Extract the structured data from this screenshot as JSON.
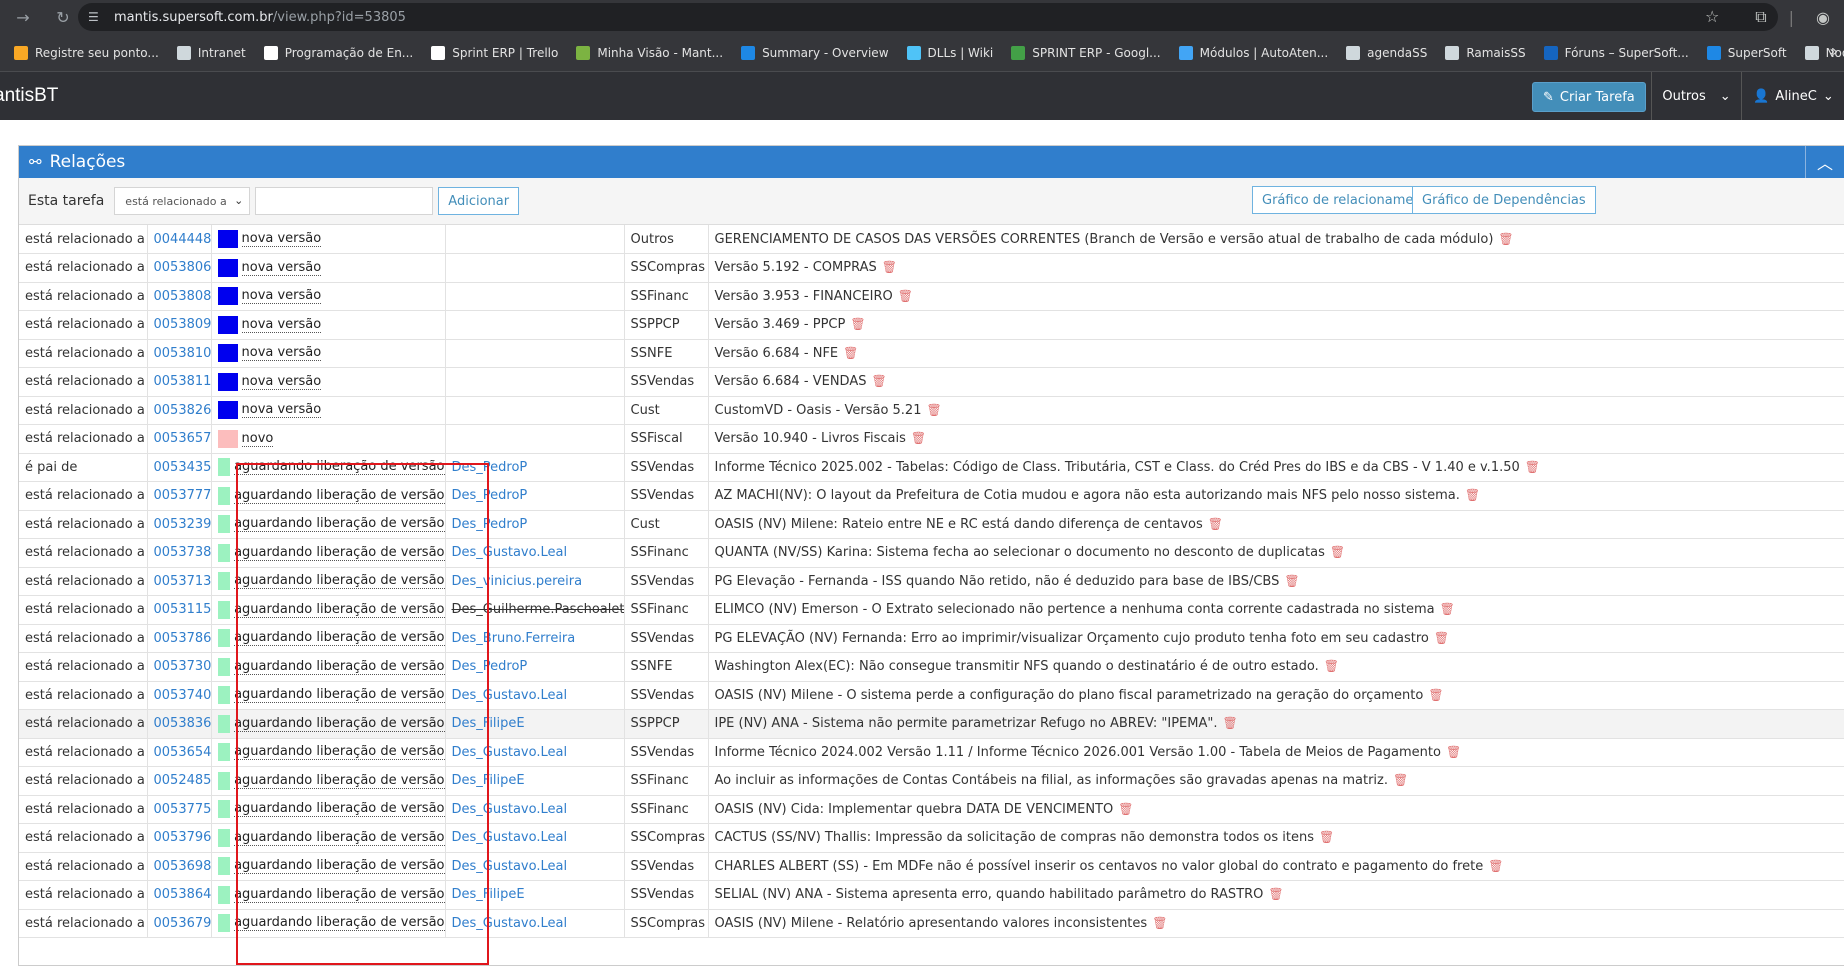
{
  "browser": {
    "url_host": "mantis.supersoft.com.br",
    "url_path": "/view.php?id=53805",
    "bookmarks": [
      {
        "label": "Registre seu ponto...",
        "color": "#f9a825"
      },
      {
        "label": "Intranet",
        "color": "#cfd8dc"
      },
      {
        "label": "Programação de En...",
        "color": "#ffffff"
      },
      {
        "label": "Sprint ERP | Trello",
        "color": "#ffffff"
      },
      {
        "label": "Minha Visão - Mant...",
        "color": "#7cb342"
      },
      {
        "label": "Summary - Overview",
        "color": "#1e88e5"
      },
      {
        "label": "DLLs | Wiki",
        "color": "#4fc3f7"
      },
      {
        "label": "SPRINT ERP - Googl...",
        "color": "#43a047"
      },
      {
        "label": "Módulos | AutoAten...",
        "color": "#42a5f5"
      },
      {
        "label": "agendaSS",
        "color": "#cfd8dc"
      },
      {
        "label": "RamaisSS",
        "color": "#cfd8dc"
      },
      {
        "label": "Fóruns – SuperSoft...",
        "color": "#1565c0"
      },
      {
        "label": "SuperSoft",
        "color": "#1e88e5"
      },
      {
        "label": "Nooven - SS Login",
        "color": "#cfd8dc"
      }
    ]
  },
  "app": {
    "brand": "antisBT",
    "create_label": "Criar Tarefa",
    "others_label": "Outros",
    "user_label": "AlineC"
  },
  "widget": {
    "title": "Relações",
    "this_task_label": "Esta tarefa",
    "relation_select": "está relacionado a",
    "add_label": "Adicionar",
    "graph_rel_label": "Gráfico de relacionamentos",
    "graph_dep_label": "Gráfico de Dependências"
  },
  "colors": {
    "nova_versao": "#0000ee",
    "novo": "#fcbdbd",
    "aguardando": "#9cf2c0"
  },
  "rows": [
    {
      "relation": "está relacionado a",
      "id": "0044448",
      "status": "nova versão",
      "color": "#0000ee",
      "handler": "",
      "project": "Outros",
      "summary": "GERENCIAMENTO DE CASOS DAS VERSÕES CORRENTES (Branch de Versão e versão atual de trabalho de cada módulo)"
    },
    {
      "relation": "está relacionado a",
      "id": "0053806",
      "status": "nova versão",
      "color": "#0000ee",
      "handler": "",
      "project": "SSCompras",
      "summary": "Versão 5.192 - COMPRAS"
    },
    {
      "relation": "está relacionado a",
      "id": "0053808",
      "status": "nova versão",
      "color": "#0000ee",
      "handler": "",
      "project": "SSFinanc",
      "summary": "Versão 3.953 - FINANCEIRO"
    },
    {
      "relation": "está relacionado a",
      "id": "0053809",
      "status": "nova versão",
      "color": "#0000ee",
      "handler": "",
      "project": "SSPPCP",
      "summary": "Versão 3.469 - PPCP"
    },
    {
      "relation": "está relacionado a",
      "id": "0053810",
      "status": "nova versão",
      "color": "#0000ee",
      "handler": "",
      "project": "SSNFE",
      "summary": "Versão 6.684 - NFE"
    },
    {
      "relation": "está relacionado a",
      "id": "0053811",
      "status": "nova versão",
      "color": "#0000ee",
      "handler": "",
      "project": "SSVendas",
      "summary": "Versão 6.684 - VENDAS"
    },
    {
      "relation": "está relacionado a",
      "id": "0053826",
      "status": "nova versão",
      "color": "#0000ee",
      "handler": "",
      "project": "Cust",
      "summary": "CustomVD - Oasis - Versão 5.21"
    },
    {
      "relation": "está relacionado a",
      "id": "0053657",
      "status": "novo",
      "color": "#fcbdbd",
      "handler": "",
      "project": "SSFiscal",
      "summary": "Versão 10.940 - Livros Fiscais"
    },
    {
      "relation": "é pai de",
      "id": "0053435",
      "status": "aguardando liberação de versão",
      "color": "#9cf2c0",
      "handler": "Des_PedroP",
      "project": "SSVendas",
      "summary": "Informe Técnico 2025.002 - Tabelas: Código de Class. Tributária, CST e Class. do Créd Pres do IBS e da CBS - V 1.40 e v.1.50"
    },
    {
      "relation": "está relacionado a",
      "id": "0053777",
      "status": "aguardando liberação de versão",
      "color": "#9cf2c0",
      "handler": "Des_PedroP",
      "project": "SSVendas",
      "summary": "AZ MACHI(NV): O layout da Prefeitura de Cotia mudou e agora não esta autorizando mais NFS pelo nosso sistema."
    },
    {
      "relation": "está relacionado a",
      "id": "0053239",
      "status": "aguardando liberação de versão",
      "color": "#9cf2c0",
      "handler": "Des_PedroP",
      "project": "Cust",
      "summary": "OASIS (NV) Milene: Rateio entre NE e RC está dando diferença de centavos"
    },
    {
      "relation": "está relacionado a",
      "id": "0053738",
      "status": "aguardando liberação de versão",
      "color": "#9cf2c0",
      "handler": "Des_Gustavo.Leal",
      "project": "SSFinanc",
      "summary": "QUANTA (NV/SS) Karina: Sistema fecha ao selecionar o documento no desconto de duplicatas"
    },
    {
      "relation": "está relacionado a",
      "id": "0053713",
      "status": "aguardando liberação de versão",
      "color": "#9cf2c0",
      "handler": "Des_vinicius.pereira",
      "project": "SSVendas",
      "summary": "PG Elevação - Fernanda - ISS quando Não retido, não é deduzido para base de IBS/CBS"
    },
    {
      "relation": "está relacionado a",
      "id": "0053115",
      "status": "aguardando liberação de versão",
      "color": "#9cf2c0",
      "handler": "Des_Guilherme.Paschoalet",
      "strike": true,
      "project": "SSFinanc",
      "summary": "ELIMCO (NV) Emerson - O Extrato selecionado não pertence a nenhuma conta corrente cadastrada no sistema"
    },
    {
      "relation": "está relacionado a",
      "id": "0053786",
      "status": "aguardando liberação de versão",
      "color": "#9cf2c0",
      "handler": "Des_Bruno.Ferreira",
      "project": "SSVendas",
      "summary": "PG ELEVAÇÃO (NV) Fernanda: Erro ao imprimir/visualizar Orçamento cujo produto tenha foto em seu cadastro"
    },
    {
      "relation": "está relacionado a",
      "id": "0053730",
      "status": "aguardando liberação de versão",
      "color": "#9cf2c0",
      "handler": "Des_PedroP",
      "project": "SSNFE",
      "summary": "Washington Alex(EC): Não consegue transmitir NFS quando o destinatário é de outro estado."
    },
    {
      "relation": "está relacionado a",
      "id": "0053740",
      "status": "aguardando liberação de versão",
      "color": "#9cf2c0",
      "handler": "Des_Gustavo.Leal",
      "project": "SSVendas",
      "summary": "OASIS (NV) Milene - O sistema perde a configuração do plano fiscal parametrizado na geração do orçamento"
    },
    {
      "relation": "está relacionado a",
      "id": "0053836",
      "status": "aguardando liberação de versão",
      "color": "#9cf2c0",
      "handler": "Des_FilipeE",
      "project": "SSPPCP",
      "summary": "IPE (NV) ANA - Sistema não permite parametrizar Refugo no ABREV: \"IPEMA\".",
      "hl": true
    },
    {
      "relation": "está relacionado a",
      "id": "0053654",
      "status": "aguardando liberação de versão",
      "color": "#9cf2c0",
      "handler": "Des_Gustavo.Leal",
      "project": "SSVendas",
      "summary": "Informe Técnico 2024.002 Versão 1.11 / Informe Técnico 2026.001 Versão 1.00 - Tabela de Meios de Pagamento"
    },
    {
      "relation": "está relacionado a",
      "id": "0052485",
      "status": "aguardando liberação de versão",
      "color": "#9cf2c0",
      "handler": "Des_FilipeE",
      "project": "SSFinanc",
      "summary": "Ao incluir as informações de Contas Contábeis na filial, as informações são gravadas apenas na matriz."
    },
    {
      "relation": "está relacionado a",
      "id": "0053775",
      "status": "aguardando liberação de versão",
      "color": "#9cf2c0",
      "handler": "Des_Gustavo.Leal",
      "project": "SSFinanc",
      "summary": "OASIS (NV) Cida: Implementar quebra DATA DE VENCIMENTO"
    },
    {
      "relation": "está relacionado a",
      "id": "0053796",
      "status": "aguardando liberação de versão",
      "color": "#9cf2c0",
      "handler": "Des_Gustavo.Leal",
      "project": "SSCompras",
      "summary": "CACTUS (SS/NV) Thallis: Impressão da solicitação de compras não demonstra todos os itens"
    },
    {
      "relation": "está relacionado a",
      "id": "0053698",
      "status": "aguardando liberação de versão",
      "color": "#9cf2c0",
      "handler": "Des_Gustavo.Leal",
      "project": "SSVendas",
      "summary": "CHARLES ALBERT (SS) - Em MDFe não é possível inserir os centavos no valor global do contrato e pagamento do frete"
    },
    {
      "relation": "está relacionado a",
      "id": "0053864",
      "status": "aguardando liberação de versão",
      "color": "#9cf2c0",
      "handler": "Des_FilipeE",
      "project": "SSVendas",
      "summary": "SELIAL (NV) ANA - Sistema apresenta erro, quando habilitado parâmetro do RASTRO"
    },
    {
      "relation": "está relacionado a",
      "id": "0053679",
      "status": "aguardando liberação de versão",
      "color": "#9cf2c0",
      "handler": "Des_Gustavo.Leal",
      "project": "SSCompras",
      "summary": "OASIS (NV) Milene - Relatório apresentando valores inconsistentes"
    }
  ]
}
